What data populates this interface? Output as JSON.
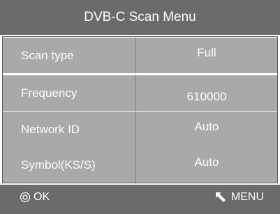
{
  "title": "DVB-C Scan Menu",
  "rows": [
    {
      "label": "Scan type",
      "value": "Full"
    },
    {
      "label": "Frequency",
      "value": "610000"
    },
    {
      "label": "Network ID",
      "value": "Auto"
    },
    {
      "label": "Symbol(KS/S)",
      "value": "Auto"
    }
  ],
  "footer": {
    "ok_label": "OK",
    "ok_icon": "ok-circle-icon",
    "menu_label": "MENU",
    "menu_icon": "back-arrow-icon"
  },
  "colors": {
    "header_bg": "#6b6b6b",
    "row_bg": "#a9a9a9",
    "text": "#ffffff"
  }
}
